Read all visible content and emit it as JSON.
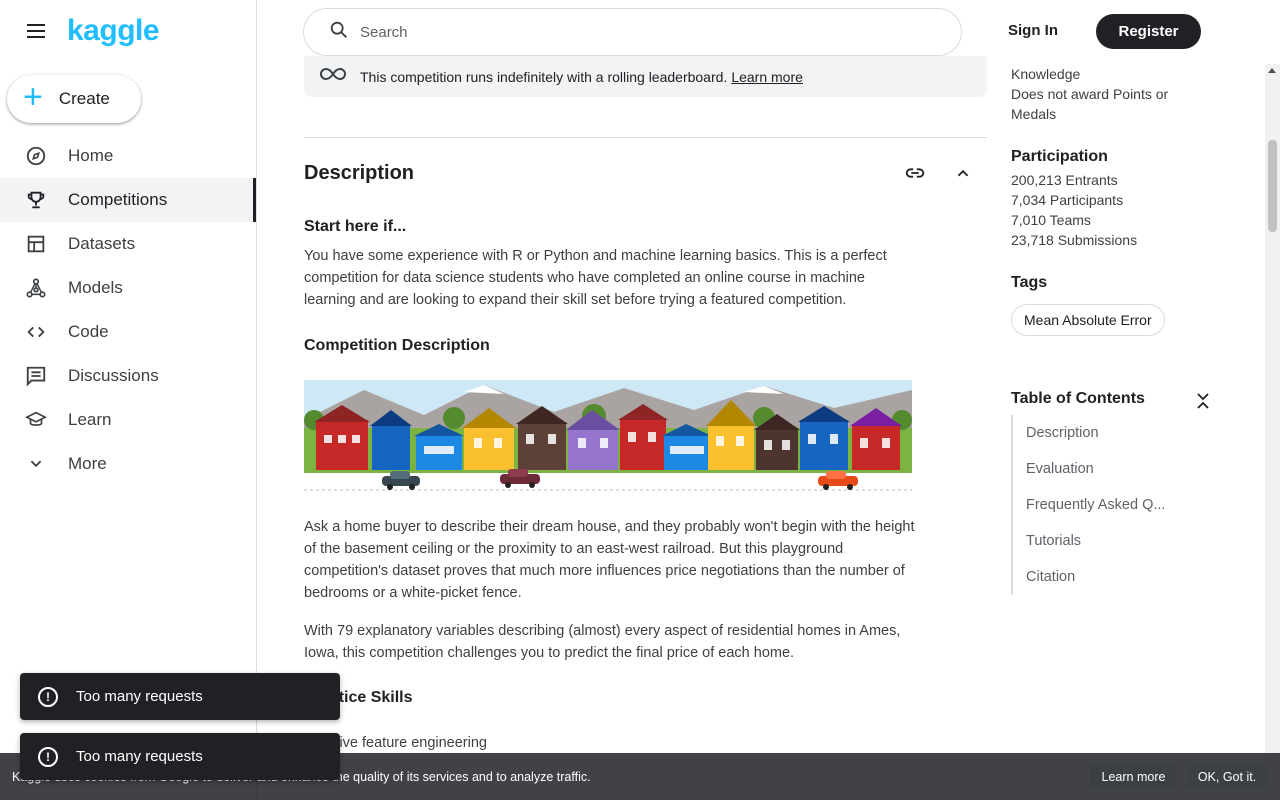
{
  "brand": {
    "logo": "kaggle",
    "accent": "#20beff"
  },
  "sidebar": {
    "create_label": "Create",
    "items": [
      {
        "label": "Home",
        "icon": "compass-icon",
        "active": false
      },
      {
        "label": "Competitions",
        "icon": "trophy-icon",
        "active": true
      },
      {
        "label": "Datasets",
        "icon": "table-icon",
        "active": false
      },
      {
        "label": "Models",
        "icon": "models-icon",
        "active": false
      },
      {
        "label": "Code",
        "icon": "code-icon",
        "active": false
      },
      {
        "label": "Discussions",
        "icon": "comment-icon",
        "active": false
      },
      {
        "label": "Learn",
        "icon": "school-icon",
        "active": false
      },
      {
        "label": "More",
        "icon": "chevron-down-icon",
        "active": false
      }
    ]
  },
  "header": {
    "search_placeholder": "Search",
    "signin_label": "Sign In",
    "register_label": "Register"
  },
  "banner": {
    "text": "This competition runs indefinitely with a rolling leaderboard.",
    "link": "Learn more"
  },
  "description": {
    "title": "Description",
    "start_heading": "Start here if...",
    "start_text": "You have some experience with R or Python and machine learning basics. This is a perfect competition for data science students who have completed an online course in machine learning and are looking to expand their skill set before trying a featured competition.",
    "comp_heading": "Competition Description",
    "para1": "Ask a home buyer to describe their dream house, and they probably won't begin with the height of the basement ceiling or the proximity to an east-west railroad. But this playground competition's dataset proves that much more influences price negotiations than the number of bedrooms or a white-picket fence.",
    "para2": "With 79 explanatory variables describing (almost) every aspect of residential homes in Ames, Iowa, this competition challenges you to predict the final price of each home.",
    "practice_heading": "Practice Skills",
    "practice_item": "Creative feature engineering"
  },
  "right_panel": {
    "knowledge_line1": "Knowledge",
    "knowledge_line2": "Does not award Points or",
    "knowledge_line3": "Medals",
    "participation_heading": "Participation",
    "entrants": "200,213 Entrants",
    "participants": "7,034 Participants",
    "teams": "7,010 Teams",
    "submissions": "23,718 Submissions",
    "tags_heading": "Tags",
    "tag": "Mean Absolute Error",
    "toc_heading": "Table of Contents",
    "toc": [
      "Description",
      "Evaluation",
      "Frequently Asked Q...",
      "Tutorials",
      "Citation"
    ]
  },
  "toasts": [
    "Too many requests",
    "Too many requests"
  ],
  "cookie": {
    "text": "Kaggle uses cookies from Google to deliver and enhance the quality of its services and to analyze traffic.",
    "learn_more": "Learn more",
    "ok": "OK, Got it."
  }
}
